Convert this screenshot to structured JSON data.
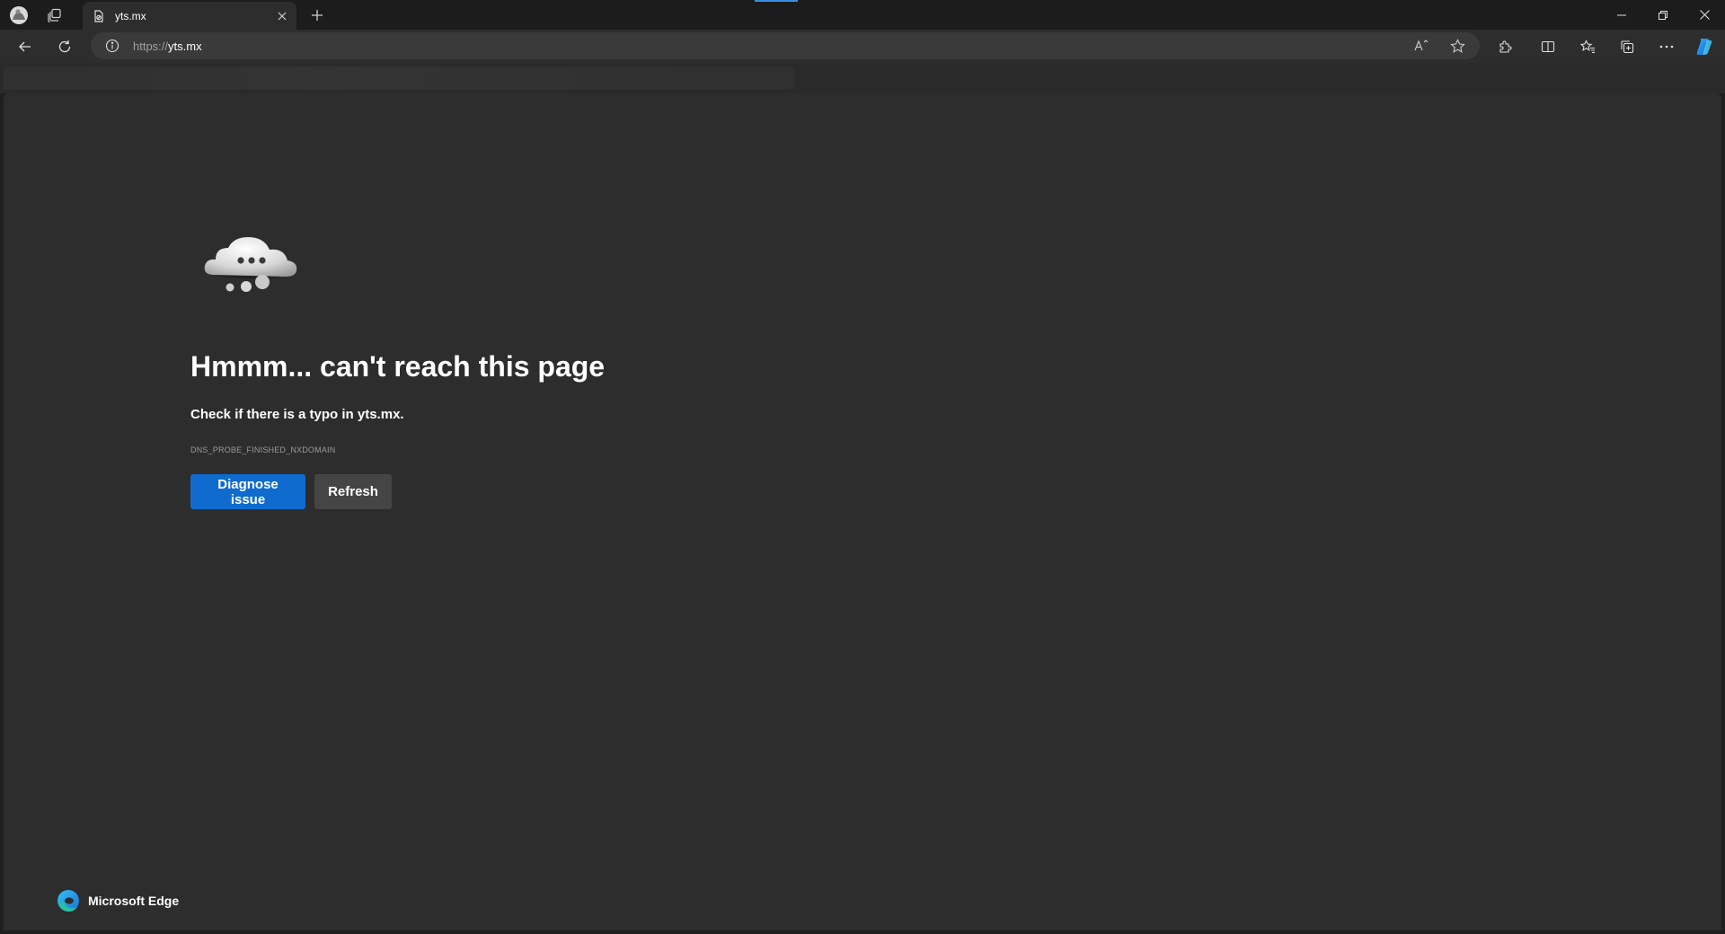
{
  "tab": {
    "title": "yts.mx"
  },
  "address": {
    "scheme": "https://",
    "host": "yts.mx"
  },
  "error": {
    "heading": "Hmmm... can't reach this page",
    "message": "Check if there is a typo in yts.mx.",
    "code": "DNS_PROBE_FINISHED_NXDOMAIN",
    "primary_button": "Diagnose issue",
    "secondary_button": "Refresh"
  },
  "footer": {
    "brand": "Microsoft Edge"
  },
  "icons": {
    "profile": "profile-avatar-icon",
    "workspaces": "workspaces-icon",
    "tab_favicon": "broken-page-icon",
    "tab_close": "close-icon",
    "new_tab": "plus-icon",
    "back": "back-arrow-icon",
    "refresh": "refresh-icon",
    "site_info": "info-icon",
    "read_aloud": "read-aloud-icon",
    "favorite": "star-icon",
    "extensions": "extensions-icon",
    "split_screen": "split-screen-icon",
    "favorites": "favorites-icon",
    "collections": "collections-icon",
    "menu": "more-icon",
    "copilot": "copilot-icon",
    "minimize": "minimize-icon",
    "restore": "restore-icon",
    "close_window": "close-window-icon",
    "cloud": "cloud-error-icon",
    "edge_logo": "edge-logo-icon"
  },
  "colors": {
    "accent": "#0f6cce",
    "page_background": "#2d2d2d",
    "chrome_background": "#1c1c1c"
  }
}
